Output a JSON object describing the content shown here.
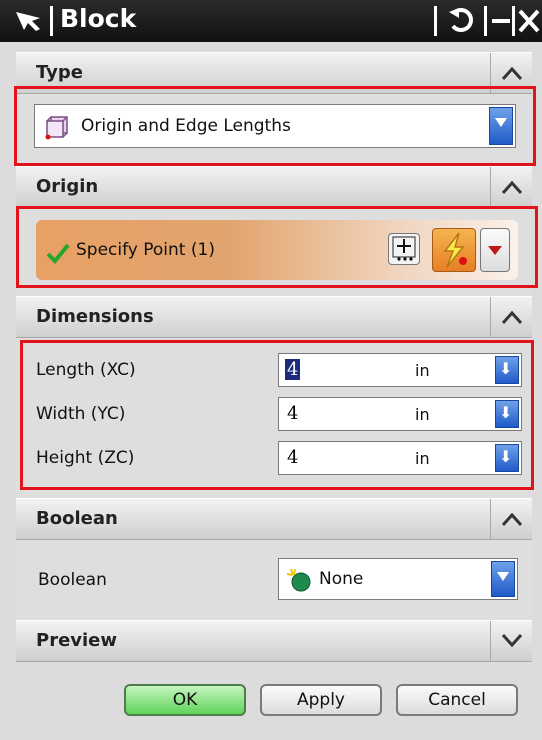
{
  "window": {
    "title": "Block"
  },
  "sections": {
    "type": {
      "title": "Type",
      "selected": "Origin and Edge Lengths"
    },
    "origin": {
      "title": "Origin",
      "specify_point": "Specify Point (1)"
    },
    "dimensions": {
      "title": "Dimensions",
      "rows": [
        {
          "label": "Length (XC)",
          "value": "4",
          "unit": "in"
        },
        {
          "label": "Width (YC)",
          "value": "4",
          "unit": "in"
        },
        {
          "label": "Height (ZC)",
          "value": "4",
          "unit": "in"
        }
      ]
    },
    "boolean": {
      "title": "Boolean",
      "label": "Boolean",
      "selected": "None"
    },
    "preview": {
      "title": "Preview"
    }
  },
  "buttons": {
    "ok": "OK",
    "apply": "Apply",
    "cancel": "Cancel"
  },
  "colors": {
    "highlight_border": "#e1141b",
    "origin_bar": "#e2a46e",
    "dropdown_arrow": "#1f5bc9",
    "ok_button": "#5fd35a"
  },
  "icons": {
    "title": "select-arrow-icon",
    "type": "block-cube-icon",
    "origin_check": "checkmark-icon",
    "point_dialog": "point-dialog-icon",
    "inferred_point": "lightning-point-icon",
    "boolean_none": "boolean-none-icon"
  }
}
